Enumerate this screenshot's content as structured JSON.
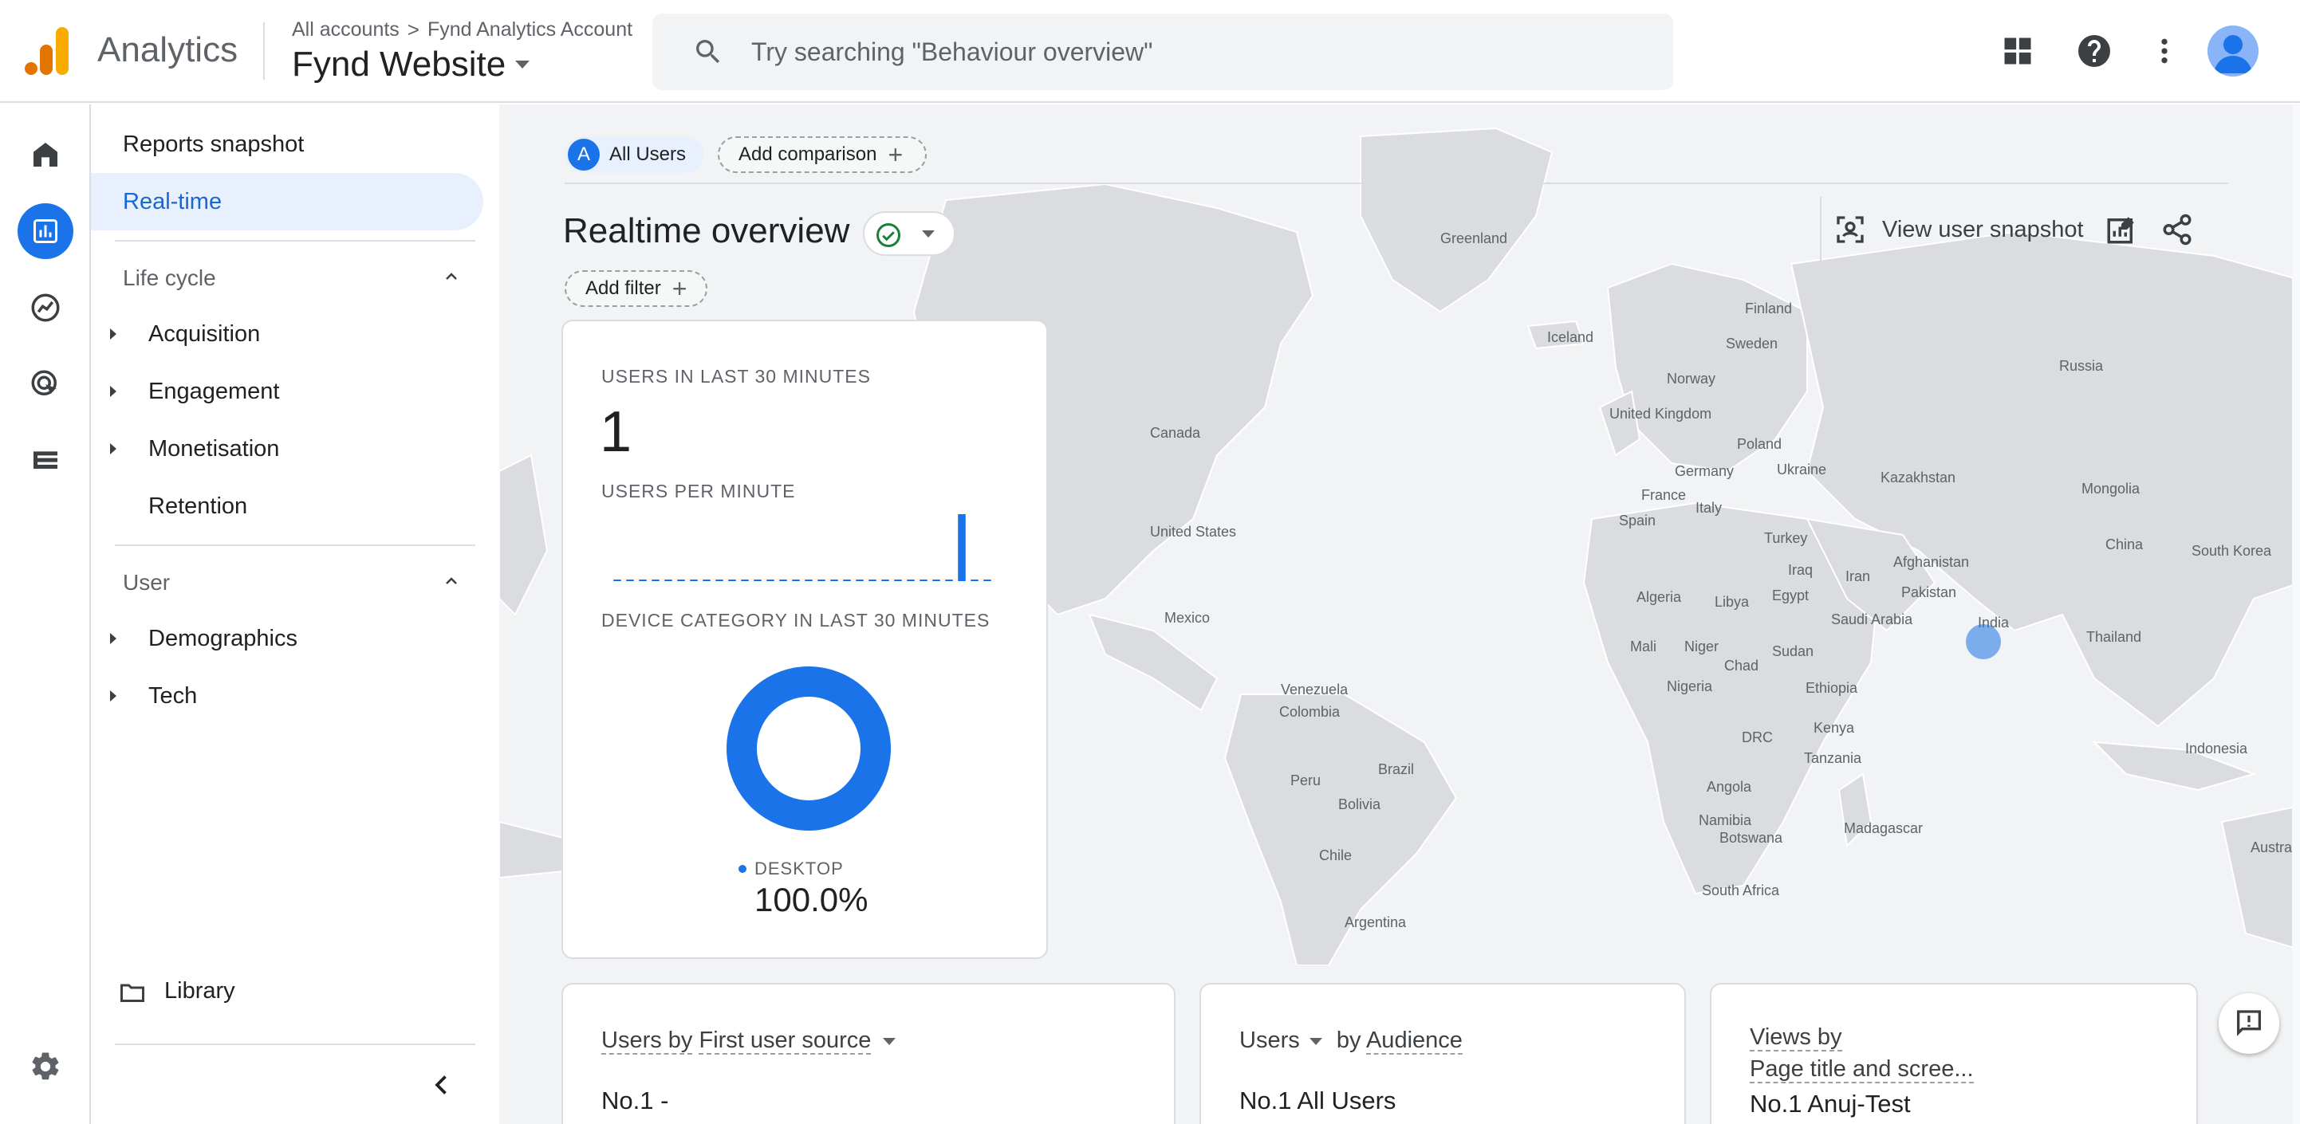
{
  "header": {
    "app_name": "Analytics",
    "breadcrumb_root": "All accounts",
    "breadcrumb_separator": ">",
    "breadcrumb_account": "Fynd Analytics Account",
    "property_name": "Fynd Website",
    "search_placeholder": "Try searching \"Behaviour overview\"",
    "logo_colors": [
      "#f9ab00",
      "#e37400"
    ]
  },
  "rail": {
    "items": [
      "home-icon",
      "reports-icon",
      "explore-icon",
      "advertising-icon",
      "configure-icon"
    ],
    "active": "reports-icon",
    "settings": "gear-icon"
  },
  "nav": {
    "reports_snapshot": "Reports snapshot",
    "realtime": "Real-time",
    "lifecycle": {
      "title": "Life cycle",
      "items": [
        "Acquisition",
        "Engagement",
        "Monetisation",
        "Retention"
      ]
    },
    "user": {
      "title": "User",
      "items": [
        "Demographics",
        "Tech"
      ]
    },
    "library": "Library"
  },
  "main": {
    "chips": {
      "badge": "A",
      "all_users": "All Users",
      "add_comparison": "Add comparison",
      "plus": "+"
    },
    "title": "Realtime overview",
    "add_filter": "Add filter",
    "view_user_snapshot": "View user snapshot",
    "map_labels": [
      "Greenland",
      "Iceland",
      "Finland",
      "Sweden",
      "Norway",
      "Russia",
      "United Kingdom",
      "Poland",
      "Germany",
      "Ukraine",
      "Kazakhstan",
      "Mongolia",
      "France",
      "Italy",
      "Spain",
      "Turkey",
      "China",
      "South Korea",
      "Canada",
      "United States",
      "Mexico",
      "Iraq",
      "Iran",
      "Afghanistan",
      "Pakistan",
      "India",
      "Thailand",
      "Algeria",
      "Libya",
      "Egypt",
      "Saudi Arabia",
      "Mali",
      "Niger",
      "Chad",
      "Sudan",
      "Nigeria",
      "Ethiopia",
      "Venezuela",
      "Colombia",
      "Brazil",
      "Peru",
      "Bolivia",
      "Chile",
      "Argentina",
      "DRC",
      "Kenya",
      "Tanzania",
      "Angola",
      "Namibia",
      "Botswana",
      "Madagascar",
      "South Africa",
      "Indonesia",
      "Australia"
    ],
    "realtime_card": {
      "users_label": "USERS IN LAST 30 MINUTES",
      "users_value": "1",
      "per_minute_label": "USERS PER MINUTE",
      "device_label": "DEVICE CATEGORY IN LAST 30 MINUTES",
      "device_legend": "DESKTOP",
      "device_pct": "100.0%",
      "accent": "#1a73e8"
    },
    "bottom_cards": [
      {
        "h_prefix": "Users by",
        "h_dim": "First user source",
        "row": "No.1  -"
      },
      {
        "h_prefix": "Users",
        "h_mid": "by",
        "h_dim": "Audience",
        "row": "No.1  All Users"
      },
      {
        "h_prefix": "Views by",
        "h_dim": "Page title and scree...",
        "row": "No.1  Anuj-Test"
      }
    ]
  },
  "chart_data": [
    {
      "type": "bar",
      "title": "USERS PER MINUTE",
      "x": [
        -29,
        -28,
        -27,
        -26,
        -25,
        -24,
        -23,
        -22,
        -21,
        -20,
        -19,
        -18,
        -17,
        -16,
        -15,
        -14,
        -13,
        -12,
        -11,
        -10,
        -9,
        -8,
        -7,
        -6,
        -5,
        -4,
        -3,
        -2,
        -1,
        0
      ],
      "values": [
        0,
        0,
        0,
        0,
        0,
        0,
        0,
        0,
        0,
        0,
        0,
        0,
        0,
        0,
        0,
        0,
        0,
        0,
        0,
        0,
        0,
        0,
        0,
        0,
        0,
        0,
        0,
        1,
        0,
        0
      ],
      "ylim": [
        0,
        1
      ]
    },
    {
      "type": "pie",
      "title": "DEVICE CATEGORY IN LAST 30 MINUTES",
      "categories": [
        "DESKTOP"
      ],
      "values": [
        100.0
      ]
    }
  ]
}
